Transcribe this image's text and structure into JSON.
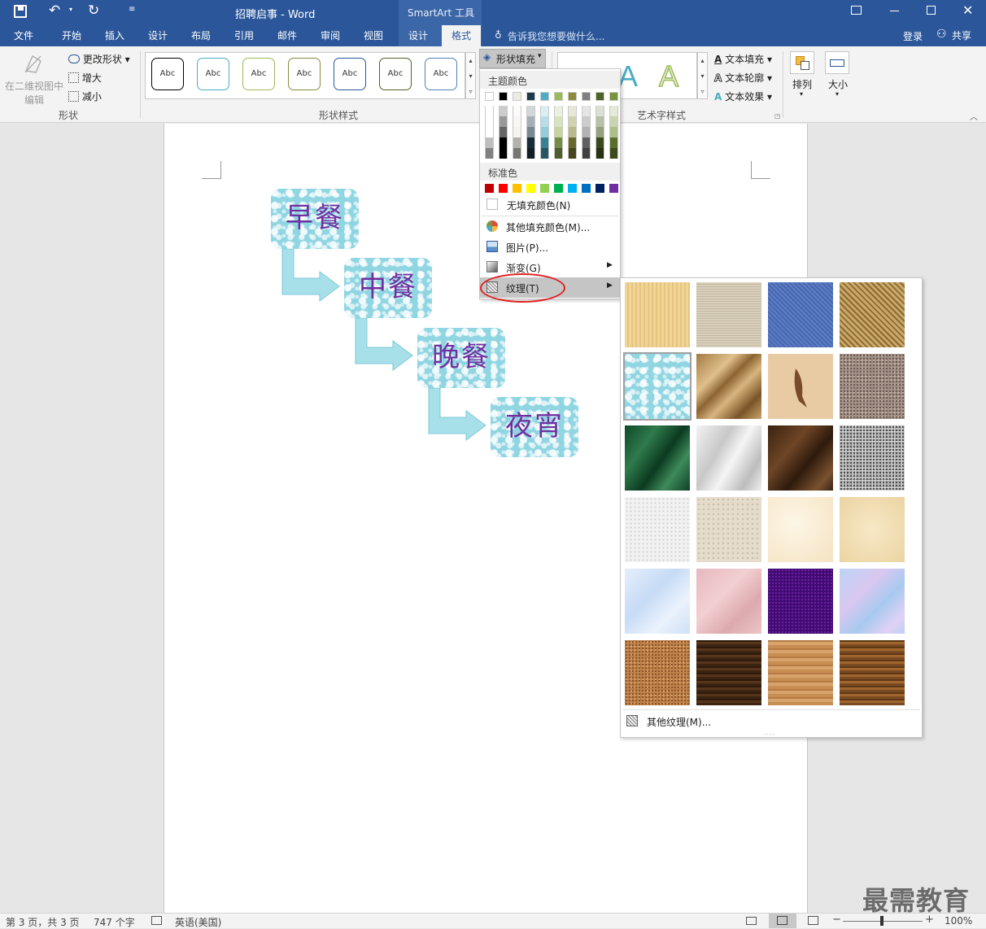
{
  "window": {
    "title": "招聘启事 - Word",
    "context_tab_group": "SmartArt 工具",
    "share": "共享",
    "login": "登录"
  },
  "qat": {
    "save": "save-icon",
    "undo": "undo-icon",
    "redo": "redo-icon",
    "customize": "customize-icon"
  },
  "tabs": [
    "文件",
    "开始",
    "插入",
    "设计",
    "布局",
    "引用",
    "邮件",
    "审阅",
    "视图",
    "设计",
    "格式"
  ],
  "tell_me": "告诉我您想要做什么...",
  "ribbon": {
    "shapes_group": {
      "edit_in_2d_line1": "在二维视图中",
      "edit_in_2d_line2": "编辑",
      "change_shape": "更改形状",
      "larger": "增大",
      "smaller": "减小",
      "label": "形状"
    },
    "shape_styles": {
      "abc": "Abc",
      "label": "形状样式",
      "colors": [
        "#000000",
        "#4bacc6",
        "#9bbb59",
        "#8b8b3a",
        "#2b579a",
        "#4f6228",
        "#4f81bd"
      ]
    },
    "shape_fill": "形状填充",
    "wordart": {
      "label": "艺术字样式",
      "letter": "A",
      "text_fill": "文本填充",
      "text_outline": "文本轮廓",
      "text_effects": "文本效果"
    },
    "arrange": "排列",
    "size": "大小"
  },
  "smartart": {
    "items": [
      "早餐",
      "中餐",
      "晚餐",
      "夜宵"
    ]
  },
  "fill_menu": {
    "theme_colors_label": "主题颜色",
    "theme_top": [
      "#ffffff",
      "#000000",
      "#eeece1",
      "#1f3a48",
      "#4bacc6",
      "#9bbb59",
      "#8b8b3a",
      "#7f7f7f",
      "#4f6228",
      "#77933c"
    ],
    "standard_colors_label": "标准色",
    "standard": [
      "#c00000",
      "#ff0000",
      "#ffc000",
      "#ffff00",
      "#92d050",
      "#00b050",
      "#00b0f0",
      "#0070c0",
      "#002060",
      "#7030a0"
    ],
    "no_fill": "无填充颜色(N)",
    "more_colors": "其他填充颜色(M)...",
    "picture": "图片(P)...",
    "gradient": "渐变(G)",
    "texture": "纹理(T)"
  },
  "texture_menu": {
    "more": "其他纹理(M)..."
  },
  "status": {
    "page": "第 3 页，共 3 页",
    "words": "747 个字",
    "language": "英语(美国)",
    "zoom": "100%"
  },
  "watermark": "最需教育"
}
